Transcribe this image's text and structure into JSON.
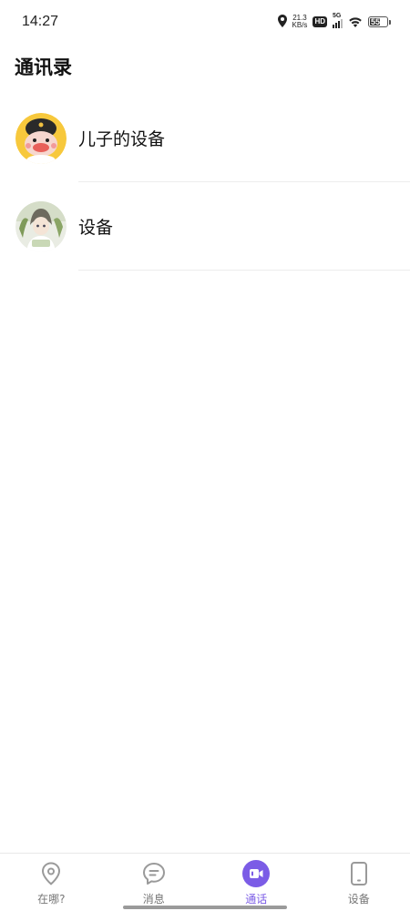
{
  "status_bar": {
    "time": "14:27",
    "net_speed_value": "21.3",
    "net_speed_unit": "KB/s",
    "hd_badge": "HD",
    "network_type": "5G",
    "battery_level": "55",
    "icons": [
      "location-icon",
      "hd-icon",
      "signal-icon",
      "wifi-icon",
      "battery-icon"
    ]
  },
  "page": {
    "title": "通讯录"
  },
  "contacts": [
    {
      "name": "儿子的设备",
      "avatar_icon": "cartoon-character-avatar"
    },
    {
      "name": "设备",
      "avatar_icon": "anime-girl-avatar"
    }
  ],
  "tab_bar": {
    "active_tab": "通话",
    "accent_color": "#7b5ce6",
    "tabs": [
      {
        "label": "在哪?",
        "icon": "location-pin-icon"
      },
      {
        "label": "消息",
        "icon": "chat-bubble-icon"
      },
      {
        "label": "通话",
        "icon": "video-call-icon"
      },
      {
        "label": "设备",
        "icon": "phone-device-icon"
      }
    ]
  }
}
